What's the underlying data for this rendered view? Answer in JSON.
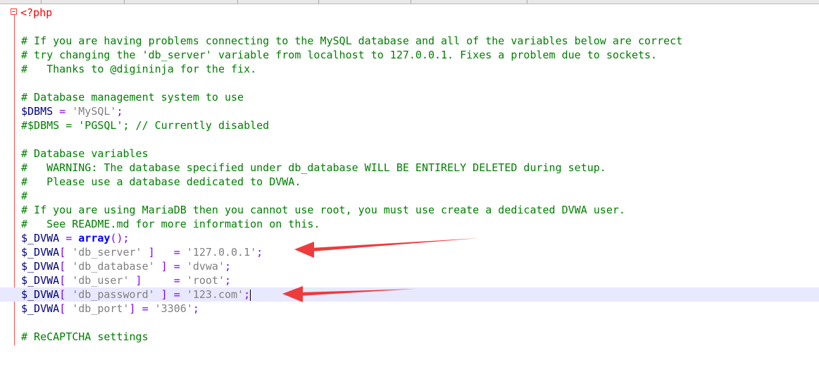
{
  "editor": {
    "lines": {
      "php_open": "<?php",
      "c1": "# If you are having problems connecting to the MySQL database and all of the variables below are correct",
      "c2": "# try changing the 'db_server' variable from localhost to 127.0.0.1. Fixes a problem due to sockets.",
      "c3": "#   Thanks to @digininja for the fix.",
      "c4": "# Database management system to use",
      "dbms_var": "$DBMS",
      "dbms_eq": " = ",
      "dbms_val": "'MySQL'",
      "dbms_semi": ";",
      "c5": "#$DBMS = 'PGSQL'; // Currently disabled",
      "c6": "# Database variables",
      "c7": "#   WARNING: The database specified under db_database WILL BE ENTIRELY DELETED during setup.",
      "c8": "#   Please use a database dedicated to DVWA.",
      "c9": "#",
      "c10": "# If you are using MariaDB then you cannot use root, you must use create a dedicated DVWA user.",
      "c11": "#   See README.md for more information on this.",
      "dvwa_var": "$_DVWA",
      "arr_eq": " = ",
      "arr_kw": "array",
      "arr_end": "();",
      "br_open": "[ ",
      "br_open_nospace": "[ ",
      "br_close": " ]",
      "br_close_nospace": "]",
      "k_server": "'db_server'",
      "k_server_eq": "   = ",
      "v_server": "'127.0.0.1'",
      "k_database": "'db_database'",
      "k_database_eq": " = ",
      "v_database": "'dvwa'",
      "k_user": "'db_user'",
      "k_user_eq": "     = ",
      "v_user": "'root'",
      "k_password": "'db_password'",
      "k_password_eq": " = ",
      "v_password": "'123.com'",
      "k_port": "'db_port'",
      "k_port_eq": " = ",
      "v_port": "'3306'",
      "semi": ";",
      "c12": "# ReCAPTCHA settings"
    }
  },
  "colors": {
    "comment": "#008000",
    "variable": "#000080",
    "operator": "#8000ff",
    "string": "#808080",
    "keyword": "#0000ff",
    "annotation_arrow": "#ee3b3b"
  }
}
